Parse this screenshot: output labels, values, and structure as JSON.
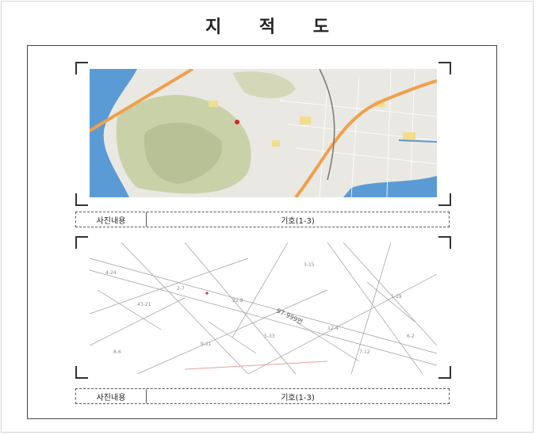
{
  "title": "지 적 도",
  "panels": [
    {
      "kind": "aerial-map",
      "caption_label": "사진내용",
      "caption_value": "기호(1-3)"
    },
    {
      "kind": "cadastral-map",
      "caption_label": "사진내용",
      "caption_value": "기호(1-3)",
      "parcel_label": "97-999번"
    }
  ],
  "colors": {
    "water": "#5b9bd5",
    "land": "#e9e8e2",
    "hills": "#c9d1a8",
    "highway": "#f0a04b",
    "frame": "#444444"
  }
}
